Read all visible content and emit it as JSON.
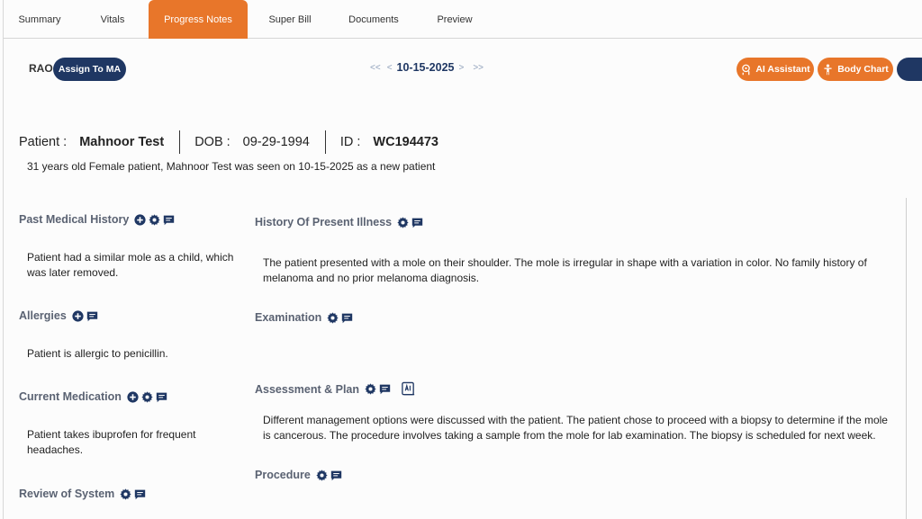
{
  "tabs": [
    {
      "label": "Summary"
    },
    {
      "label": "Vitals"
    },
    {
      "label": "Progress Notes"
    },
    {
      "label": "Super Bill"
    },
    {
      "label": "Documents"
    },
    {
      "label": "Preview"
    }
  ],
  "active_tab": "Progress Notes",
  "header": {
    "provider": "RAO",
    "assign_label": "Assign To MA",
    "nav_first": "<<",
    "nav_prev": "<",
    "date": "10-15-2025",
    "nav_next": ">",
    "nav_last": ">>",
    "ai_label": "AI Assistant",
    "body_chart_label": "Body Chart"
  },
  "patient": {
    "name_label": "Patient :",
    "name": "Mahnoor Test",
    "dob_label": "DOB :",
    "dob": "09-29-1994",
    "id_label": "ID :",
    "id": "WC194473",
    "summary": "31 years old Female patient, Mahnoor Test was seen on 10-15-2025 as a new patient"
  },
  "sections": {
    "past_medical_history": {
      "title": "Past Medical History",
      "text": "Patient had a similar mole as a child, which was later removed."
    },
    "allergies": {
      "title": "Allergies",
      "text": "Patient is allergic to penicillin."
    },
    "current_medication": {
      "title": "Current Medication",
      "text": "Patient takes ibuprofen for frequent headaches."
    },
    "review_of_system": {
      "title": "Review of System"
    },
    "history_present_illness": {
      "title": "History Of Present Illness",
      "text": "The patient presented with a mole on their shoulder. The mole is irregular in shape with a variation in color. No family history of melanoma and no prior melanoma diagnosis."
    },
    "examination": {
      "title": "Examination"
    },
    "assessment_plan": {
      "title": "Assessment & Plan",
      "text": "Different management options were discussed with the patient. The patient chose to proceed with a biopsy to determine if the mole is cancerous. The procedure involves taking a sample from the mole for lab examination. The biopsy is scheduled for next week."
    },
    "procedure": {
      "title": "Procedure"
    }
  },
  "colors": {
    "accent": "#e8762a",
    "navy": "#1f3763",
    "section_title": "#5a6272"
  }
}
